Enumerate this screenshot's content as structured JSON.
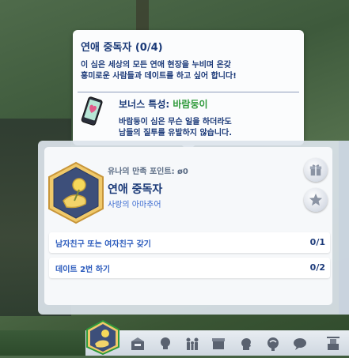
{
  "tooltip": {
    "title": "연애 중독자 (0/4)",
    "desc_line1": "이 심은 세상의 모든 연애 현장을 누비며 온갖",
    "desc_line2": "흥미로운 사람들과 데이트를 하고 싶어 합니다!",
    "bonus_prefix": "보너스 특성: ",
    "bonus_trait": "바람둥이",
    "bonus_line1": "바람둥이 심은 무슨 일을 하더라도",
    "bonus_line2": "남들의 질투를 유발하지 않습니다."
  },
  "panel": {
    "points_label": "유나의 만족 포인트: ",
    "points_value": "0",
    "aspiration_name": "연애 중독자",
    "aspiration_category": "사랑의 아마추어"
  },
  "tasks": [
    {
      "label": "남자친구 또는 여자친구 갖기",
      "progress": "0/1"
    },
    {
      "label": "데이트 2번 하기",
      "progress": "0/2"
    }
  ],
  "colors": {
    "title": "#1b3a78",
    "trait_green": "#2f9a3b",
    "task_text": "#2b5bbd"
  },
  "icons": [
    "phone-trait-icon",
    "aspiration-emblem-icon",
    "gift-icon",
    "star-icon",
    "mailbox-icon",
    "lightbulb-icon",
    "family-icon",
    "box-icon",
    "head-icon",
    "brain-icon",
    "speech-bubble-icon",
    "simology-icon"
  ]
}
